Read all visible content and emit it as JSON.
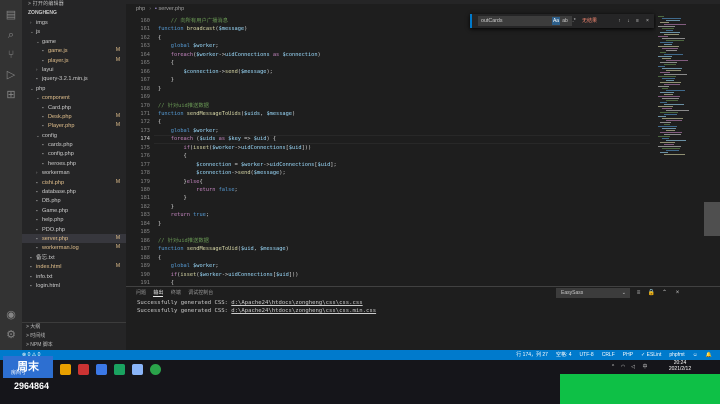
{
  "sidebar": {
    "open_editors_header": "> 打开的编辑器",
    "project_name": "ZONGHENG",
    "tree": [
      {
        "label": "imgs",
        "type": "folder-closed",
        "indent": 1
      },
      {
        "label": "js",
        "type": "folder-open",
        "indent": 1
      },
      {
        "label": "game",
        "type": "folder-open",
        "indent": 2
      },
      {
        "label": "game.js",
        "type": "js",
        "indent": 3,
        "mark": "M"
      },
      {
        "label": "player.js",
        "type": "js",
        "indent": 3,
        "mark": "M"
      },
      {
        "label": "layui",
        "type": "folder-closed",
        "indent": 2
      },
      {
        "label": "jquery-3.2.1.min.js",
        "type": "js",
        "indent": 2
      },
      {
        "label": "php",
        "type": "folder-open",
        "indent": 1
      },
      {
        "label": "component",
        "type": "folder-open-m",
        "indent": 2
      },
      {
        "label": "Card.php",
        "type": "php",
        "indent": 3
      },
      {
        "label": "Desk.php",
        "type": "php-m",
        "indent": 3,
        "mark": "M"
      },
      {
        "label": "Player.php",
        "type": "php-m",
        "indent": 3,
        "mark": "M"
      },
      {
        "label": "config",
        "type": "folder-open",
        "indent": 2
      },
      {
        "label": "cards.php",
        "type": "php",
        "indent": 3
      },
      {
        "label": "config.php",
        "type": "php",
        "indent": 3
      },
      {
        "label": "heroes.php",
        "type": "php",
        "indent": 3
      },
      {
        "label": "workerman",
        "type": "folder-closed",
        "indent": 2
      },
      {
        "label": "cishi.php",
        "type": "php-m",
        "indent": 2,
        "mark": "M"
      },
      {
        "label": "database.php",
        "type": "php",
        "indent": 2
      },
      {
        "label": "DB.php",
        "type": "php",
        "indent": 2
      },
      {
        "label": "Game.php",
        "type": "php",
        "indent": 2
      },
      {
        "label": "help.php",
        "type": "php",
        "indent": 2
      },
      {
        "label": "PDO.php",
        "type": "php",
        "indent": 2
      },
      {
        "label": "server.php",
        "type": "php-m",
        "indent": 2,
        "mark": "M",
        "selected": true
      },
      {
        "label": "workerman.log",
        "type": "log",
        "indent": 2,
        "mark": "M"
      },
      {
        "label": "备忘.txt",
        "type": "txt",
        "indent": 1
      },
      {
        "label": "index.html",
        "type": "html-m",
        "indent": 1,
        "mark": "M"
      },
      {
        "label": "info.txt",
        "type": "txt",
        "indent": 1
      },
      {
        "label": "login.html",
        "type": "html",
        "indent": 1
      }
    ],
    "outline": [
      "> 大纲",
      "> 时间线",
      "> NPM 脚本"
    ]
  },
  "breadcrumb": [
    "php",
    "server.php"
  ],
  "editor": {
    "current_line": 174,
    "lines": [
      {
        "n": "160",
        "t": [
          [
            "    ",
            "op"
          ],
          [
            "// 向所有用户广播消息",
            "cm"
          ]
        ]
      },
      {
        "n": "161",
        "t": [
          [
            "function ",
            "kw"
          ],
          [
            "broadcast",
            "fn"
          ],
          [
            "(",
            "op"
          ],
          [
            "$message",
            "vr"
          ],
          [
            ")",
            "op"
          ]
        ]
      },
      {
        "n": "162",
        "t": [
          [
            "{",
            "op"
          ]
        ]
      },
      {
        "n": "163",
        "t": [
          [
            "    global ",
            "kw"
          ],
          [
            "$worker",
            "vr"
          ],
          [
            ";",
            "op"
          ]
        ]
      },
      {
        "n": "164",
        "t": [
          [
            "    foreach",
            "pl"
          ],
          [
            "(",
            "op"
          ],
          [
            "$worker",
            "vr"
          ],
          [
            "->",
            "op"
          ],
          [
            "uidConnections",
            "vr"
          ],
          [
            " as ",
            "pl"
          ],
          [
            "$connection",
            "vr"
          ],
          [
            ")",
            "op"
          ]
        ]
      },
      {
        "n": "165",
        "t": [
          [
            "    {",
            "op"
          ]
        ]
      },
      {
        "n": "166",
        "t": [
          [
            "        ",
            "op"
          ],
          [
            "$connection",
            "vr"
          ],
          [
            "->",
            "op"
          ],
          [
            "send",
            "fn"
          ],
          [
            "(",
            "op"
          ],
          [
            "$message",
            "vr"
          ],
          [
            ");",
            "op"
          ]
        ]
      },
      {
        "n": "167",
        "t": [
          [
            "    }",
            "op"
          ]
        ]
      },
      {
        "n": "168",
        "t": [
          [
            "}",
            "op"
          ]
        ]
      },
      {
        "n": "169",
        "t": []
      },
      {
        "n": "170",
        "t": [
          [
            "// 针对uid推送数据",
            "cm"
          ]
        ]
      },
      {
        "n": "171",
        "t": [
          [
            "function ",
            "kw"
          ],
          [
            "sendMessageToUids",
            "fn"
          ],
          [
            "(",
            "op"
          ],
          [
            "$uids",
            "vr"
          ],
          [
            ", ",
            "op"
          ],
          [
            "$message",
            "vr"
          ],
          [
            ")",
            "op"
          ]
        ]
      },
      {
        "n": "172",
        "t": [
          [
            "{",
            "op"
          ]
        ]
      },
      {
        "n": "173",
        "t": [
          [
            "    global ",
            "kw"
          ],
          [
            "$worker",
            "vr"
          ],
          [
            ";",
            "op"
          ]
        ]
      },
      {
        "n": "174",
        "t": [
          [
            "    foreach ",
            "pl"
          ],
          [
            "(",
            "op"
          ],
          [
            "$uids",
            "vr"
          ],
          [
            " as ",
            "pl"
          ],
          [
            "$key",
            "vr"
          ],
          [
            " => ",
            "op"
          ],
          [
            "$uid",
            "vr"
          ],
          [
            ") {",
            "op"
          ]
        ]
      },
      {
        "n": "175",
        "t": [
          [
            "        if",
            "pl"
          ],
          [
            "(",
            "op"
          ],
          [
            "isset",
            "fn"
          ],
          [
            "(",
            "op"
          ],
          [
            "$worker",
            "vr"
          ],
          [
            "->",
            "op"
          ],
          [
            "uidConnections",
            "vr"
          ],
          [
            "[",
            "op"
          ],
          [
            "$uid",
            "vr"
          ],
          [
            "]))",
            "op"
          ]
        ]
      },
      {
        "n": "176",
        "t": [
          [
            "        {",
            "op"
          ]
        ]
      },
      {
        "n": "177",
        "t": [
          [
            "            ",
            "op"
          ],
          [
            "$connection",
            "vr"
          ],
          [
            " = ",
            "op"
          ],
          [
            "$worker",
            "vr"
          ],
          [
            "->",
            "op"
          ],
          [
            "uidConnections",
            "vr"
          ],
          [
            "[",
            "op"
          ],
          [
            "$uid",
            "vr"
          ],
          [
            "];",
            "op"
          ]
        ]
      },
      {
        "n": "178",
        "t": [
          [
            "            ",
            "op"
          ],
          [
            "$connection",
            "vr"
          ],
          [
            "->",
            "op"
          ],
          [
            "send",
            "fn"
          ],
          [
            "(",
            "op"
          ],
          [
            "$message",
            "vr"
          ],
          [
            ");",
            "op"
          ]
        ]
      },
      {
        "n": "179",
        "t": [
          [
            "        }",
            "op"
          ],
          [
            "else",
            "pl"
          ],
          [
            "{",
            "op"
          ]
        ]
      },
      {
        "n": "180",
        "t": [
          [
            "            return ",
            "pl"
          ],
          [
            "false",
            "kw"
          ],
          [
            ";",
            "op"
          ]
        ]
      },
      {
        "n": "181",
        "t": [
          [
            "        }",
            "op"
          ]
        ]
      },
      {
        "n": "182",
        "t": [
          [
            "    }",
            "op"
          ]
        ]
      },
      {
        "n": "183",
        "t": [
          [
            "    return ",
            "pl"
          ],
          [
            "true",
            "kw"
          ],
          [
            ";",
            "op"
          ]
        ]
      },
      {
        "n": "184",
        "t": [
          [
            "}",
            "op"
          ]
        ]
      },
      {
        "n": "185",
        "t": []
      },
      {
        "n": "186",
        "t": [
          [
            "// 针对uid推送数据",
            "cm"
          ]
        ]
      },
      {
        "n": "187",
        "t": [
          [
            "function ",
            "kw"
          ],
          [
            "sendMessageToUid",
            "fn"
          ],
          [
            "(",
            "op"
          ],
          [
            "$uid",
            "vr"
          ],
          [
            ", ",
            "op"
          ],
          [
            "$message",
            "vr"
          ],
          [
            ")",
            "op"
          ]
        ]
      },
      {
        "n": "188",
        "t": [
          [
            "{",
            "op"
          ]
        ]
      },
      {
        "n": "189",
        "t": [
          [
            "    global ",
            "kw"
          ],
          [
            "$worker",
            "vr"
          ],
          [
            ";",
            "op"
          ]
        ]
      },
      {
        "n": "190",
        "t": [
          [
            "    if",
            "pl"
          ],
          [
            "(",
            "op"
          ],
          [
            "isset",
            "fn"
          ],
          [
            "(",
            "op"
          ],
          [
            "$worker",
            "vr"
          ],
          [
            "->",
            "op"
          ],
          [
            "uidConnections",
            "vr"
          ],
          [
            "[",
            "op"
          ],
          [
            "$uid",
            "vr"
          ],
          [
            "]))",
            "op"
          ]
        ]
      },
      {
        "n": "191",
        "t": [
          [
            "    {",
            "op"
          ]
        ]
      }
    ]
  },
  "find": {
    "value": "outCards",
    "opt_case": "Aa",
    "opt_word": "ab",
    "opt_regex": ".*",
    "no_results": "无结果",
    "prev": "↑",
    "next": "↓",
    "selection": "≡",
    "close": "×"
  },
  "panel": {
    "tabs": [
      "问题",
      "输出",
      "终端",
      "调试控制台"
    ],
    "active_tab": 1,
    "output_channel": "EasySass",
    "output_lines": [
      {
        "prefix": "Successfully generated CSS: ",
        "path": "d:\\Apache24\\htdocs\\zongheng\\css\\css.css"
      },
      {
        "prefix": "Successfully generated CSS: ",
        "path": "d:\\Apache24\\htdocs\\zongheng\\css\\css.min.css"
      }
    ]
  },
  "status": {
    "left": "⊗ 0 ⚠ 0",
    "items": [
      "行 174，列 27",
      "空格: 4",
      "UTF-8",
      "CRLF",
      "PHP",
      "✓ ESLint",
      "phpfmt",
      "☺",
      "🔔"
    ]
  },
  "taskbar": {
    "brand_text": "周末",
    "brand_sub": "房间号",
    "room_number": "2964864",
    "time": "20:24",
    "date": "2021/2/12"
  },
  "colors": {
    "accent": "#007acc",
    "green_overlay": "#0ec046"
  }
}
